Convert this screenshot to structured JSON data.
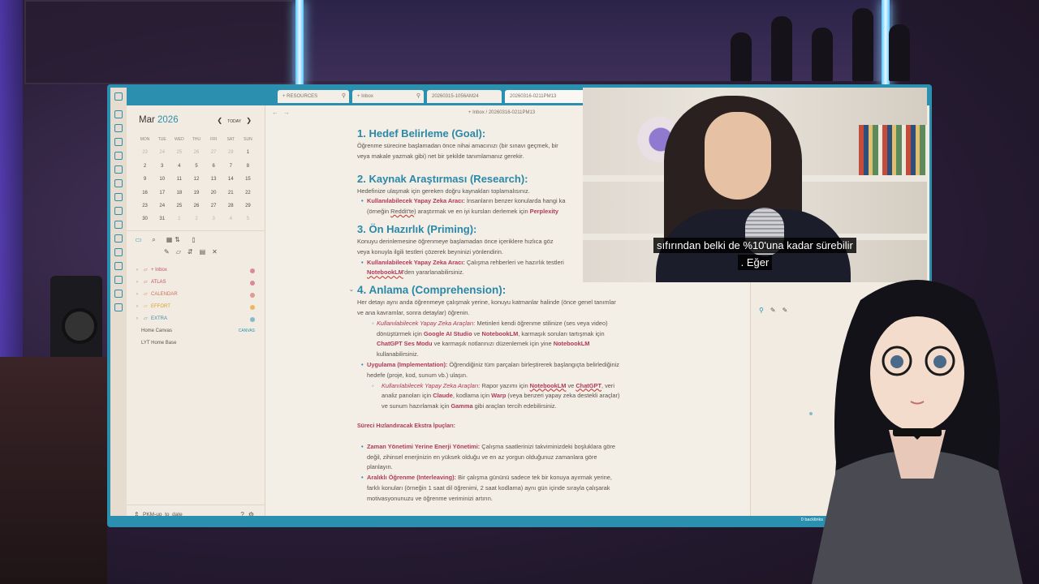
{
  "tabs": [
    {
      "label": "RESOURCES",
      "pinned": true
    },
    {
      "label": "Inbox",
      "pinned": true
    },
    {
      "label": "20260315-1056AM24",
      "pinned": false
    },
    {
      "label": "20260316-0211PM13",
      "pinned": false
    }
  ],
  "calendar": {
    "month": "Mar",
    "year": "2026",
    "today": "TODAY",
    "weekdays": [
      "MON",
      "TUE",
      "WED",
      "THU",
      "FRI",
      "SAT",
      "SUN"
    ],
    "weeks": [
      [
        "23",
        "24",
        "25",
        "26",
        "27",
        "28",
        "1"
      ],
      [
        "2",
        "3",
        "4",
        "5",
        "6",
        "7",
        "8"
      ],
      [
        "9",
        "10",
        "11",
        "12",
        "13",
        "14",
        "15"
      ],
      [
        "16",
        "17",
        "18",
        "19",
        "20",
        "21",
        "22"
      ],
      [
        "23",
        "24",
        "25",
        "26",
        "27",
        "28",
        "29"
      ],
      [
        "30",
        "31",
        "1",
        "2",
        "3",
        "4",
        "5"
      ]
    ]
  },
  "tree": [
    {
      "label": "+ Inbox",
      "color": "#c2506e",
      "dot": "#d98a9a",
      "folder": true
    },
    {
      "label": "ATLAS",
      "color": "#c2506e",
      "dot": "#d98a9a",
      "folder": true
    },
    {
      "label": "CALENDAR",
      "color": "#d0705a",
      "dot": "#e09a90",
      "folder": true
    },
    {
      "label": "EFFORT",
      "color": "#d8a030",
      "dot": "#e8b860",
      "folder": true
    },
    {
      "label": "EXTRA",
      "color": "#4a8aa0",
      "dot": "#8ab8c8",
      "folder": true
    },
    {
      "label": "Home Canvas",
      "badge": "CANVAS",
      "folder": false
    },
    {
      "label": "LYT Home Base",
      "folder": false
    }
  ],
  "vault_name": "PKM-up_to_date",
  "breadcrumb": "+ Inbox  /  20260316-0211PM13",
  "doc": {
    "h1": "1. Hedef Belirleme (Goal):",
    "p1a": "Öğrenme sürecine başlamadan önce nihai amacınızı (bir sınavı geçmek, bir",
    "p1b": "veya makale yazmak gibi) net bir şekilde tanımlamanız gerekir.",
    "h2": "2. Kaynak Araştırması (Research):",
    "p2": "Hedefinize ulaşmak için gereken doğru kaynakları toplamalısınız.",
    "b2a_kw": "Kullanılabilecek Yapay Zeka Aracı:",
    "b2a": " İnsanların benzer konularda hangi ka",
    "b2b_a": "(örneğin ",
    "b2b_reddit": "Reddit'te",
    "b2b_b": ") araştırmak ve en iyi kursları derlemek için ",
    "b2b_kw": "Perplexity",
    "h3": "3. Ön Hazırlık (Priming):",
    "p3a": "Konuyu derinlemesine öğrenmeye başlamadan önce içeriklere hızlıca göz",
    "p3b": "veya konuyla ilgili testleri çözerek beyninizi yönlendirin.",
    "b3a_kw": "Kullanılabilecek Yapay Zeka Aracı:",
    "b3a": " Çalışma rehberleri ve hazırlık testleri",
    "b3b_kw": "NotebookLM",
    "b3b": "'den yararlanabilirsiniz.",
    "h4": "4. Anlama (Comprehension):",
    "p4a": "Her detayı aynı anda öğrenmeye çalışmak yerine, konuyu katmanlar halinde (önce genel tanımlar",
    "p4b": "ve ana kavramlar, sonra detaylar) öğrenin.",
    "s4a_it": "Kullanılabilecek Yapay Zeka Araçları:",
    "s4a": " Metinleri kendi öğrenme stilinize (ses veya video)",
    "s4b_a": "dönüştürmek için ",
    "s4b_kw1": "Google AI Studio",
    "s4b_b": " ve ",
    "s4b_kw2": "NotebookLM",
    "s4b_c": ", karmaşık soruları tartışmak için",
    "s4c_kw1": "ChatGPT Ses Modu",
    "s4c_a": " ve karmaşık notlarınızı düzenlemek için yine ",
    "s4c_kw2": "NotebookLM",
    "s4d": "kullanabilirsiniz.",
    "b4a_kw": "Uygulama (Implementation):",
    "b4a": " Öğrendiğiniz tüm parçaları birleştirerek başlangıçta belirlediğiniz",
    "b4b": "hedefe (proje, kod, sunum vb.) ulaşın.",
    "s4e_it": "Kullanılabilecek Yapay Zeka Araçları:",
    "s4e_a": " Rapor yazımı için ",
    "s4e_kw1": "NotebookLM",
    "s4e_b": " ve ",
    "s4e_kw2": "ChatGPT",
    "s4e_c": ", veri",
    "s4f_a": "analiz panoları için ",
    "s4f_kw1": "Claude",
    "s4f_b": ", kodlama için ",
    "s4f_kw2": "Warp",
    "s4f_c": " (veya benzeri yapay zeka destekli araçlar)",
    "s4g_a": "ve sunum hazırlamak için ",
    "s4g_kw": "Gamma",
    "s4g_b": " gibi araçları tercih edebilirsiniz.",
    "extra_title": "Süreci Hızlandıracak Ekstra İpuçları:",
    "e1_kw": "Zaman Yönetimi Yerine Enerji Yönetimi:",
    "e1a": " Çalışma saatlerinizi takviminizdeki boşluklara göre",
    "e1b": "değil, zihinsel enerjinizin en yüksek olduğu ve en az yorgun olduğunuz zamanlara göre",
    "e1c": "planlayın.",
    "e2_kw": "Aralıklı Öğrenme (Interleaving):",
    "e2a": " Bir çalışma gününü sadece tek bir konuya ayırmak yerine,",
    "e2b": "farklı konuları (örneğin 1 saat dil öğrenimi, 2 saat kodlama) aynı gün içinde sırayla çalışarak",
    "e2c": "motivasyonunuzu ve öğrenme veriminizi artırın."
  },
  "backlinks": "0 backlinks",
  "subtitle": {
    "line1": "sıfırından belki de %10'una kadar sürebilir",
    "line2": ". Eğer"
  },
  "colors": {
    "accent": "#2a8fb0",
    "keyword": "#b03a5a",
    "heading": "#2a88a8"
  }
}
